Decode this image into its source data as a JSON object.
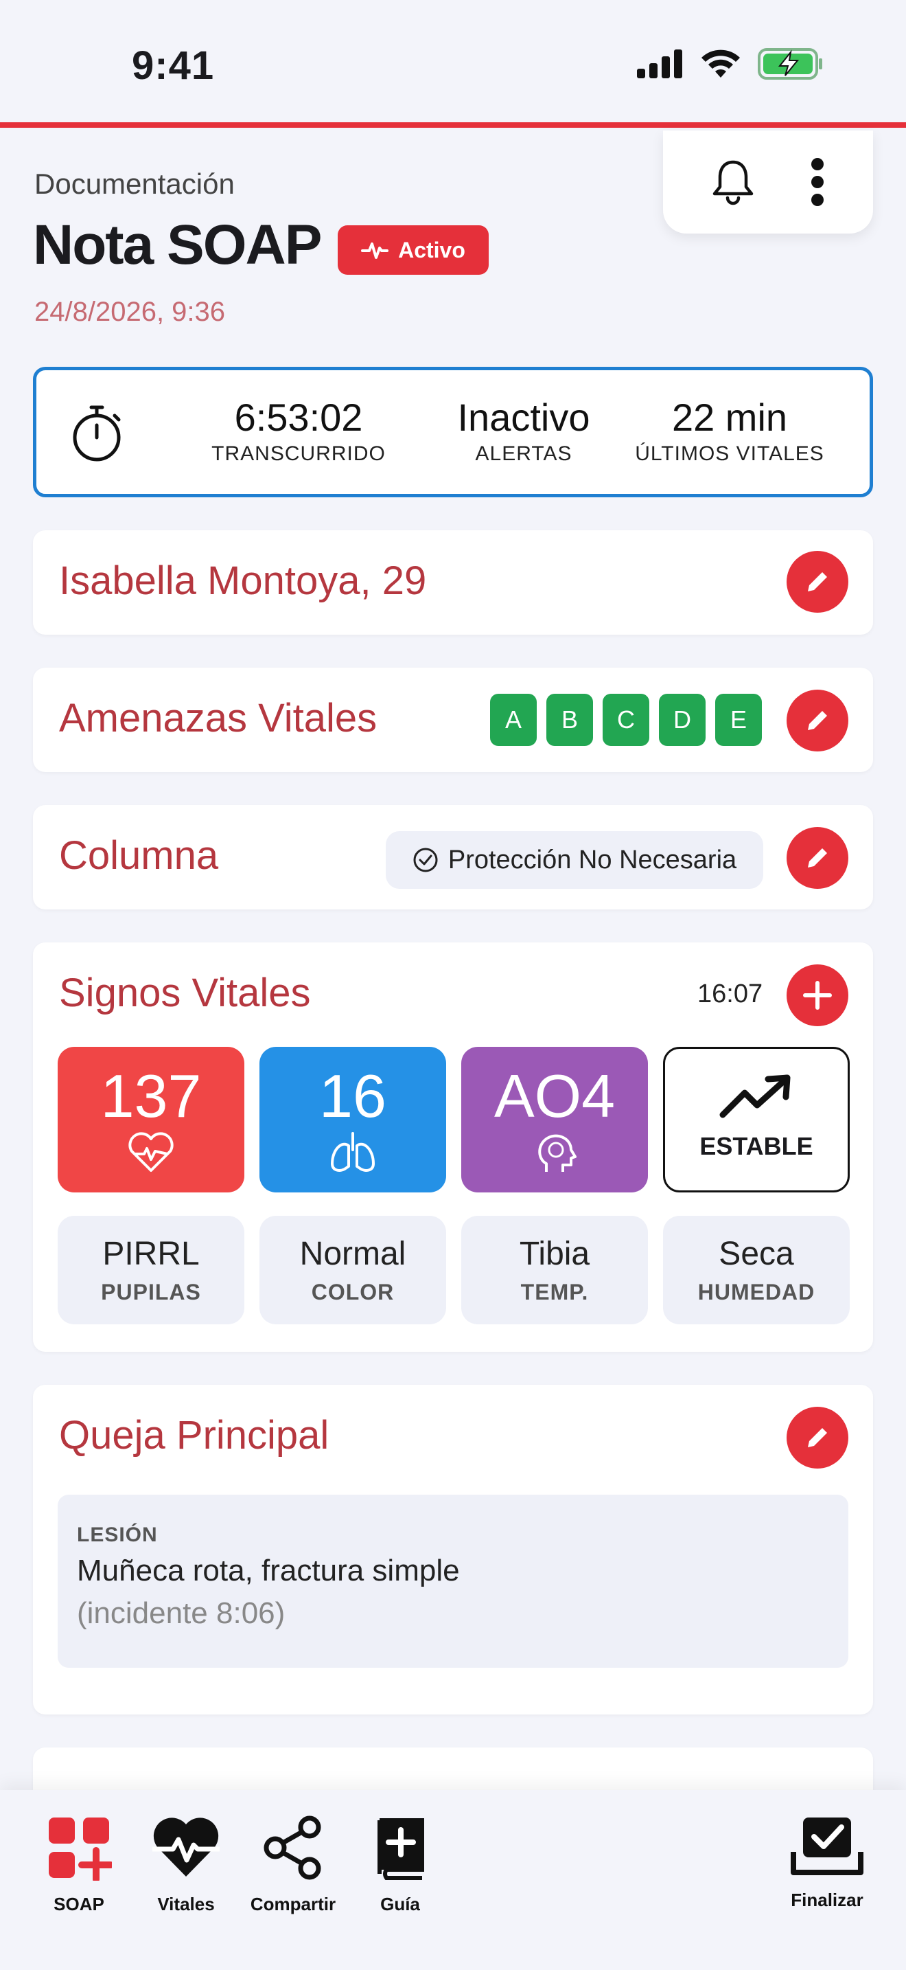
{
  "status_bar": {
    "time": "9:41"
  },
  "header": {
    "subtitle": "Documentación",
    "title": "Nota SOAP",
    "badge": "Activo",
    "date": "24/8/2026, 9:36"
  },
  "timer": {
    "stats": [
      {
        "value": "6:53:02",
        "label": "TRANSCURRIDO"
      },
      {
        "value": "Inactivo",
        "label": "ALERTAS"
      },
      {
        "value": "22 min",
        "label": "ÚLTIMOS VITALES"
      }
    ]
  },
  "patient": {
    "name": "Isabella Montoya, 29"
  },
  "threats": {
    "title": "Amenazas Vitales",
    "letters": [
      "A",
      "B",
      "C",
      "D",
      "E"
    ]
  },
  "spine": {
    "title": "Columna",
    "status": "Protección No Necesaria"
  },
  "vitals": {
    "title": "Signos Vitales",
    "time": "16:07",
    "heart_rate": "137",
    "resp_rate": "16",
    "avpu": "AO4",
    "trend": "ESTABLE",
    "colors": {
      "heart": "#f04646",
      "resp": "#2591e6",
      "neuro": "#9b59b6"
    },
    "details": [
      {
        "value": "PIRRL",
        "label": "PUPILAS"
      },
      {
        "value": "Normal",
        "label": "COLOR"
      },
      {
        "value": "Tibia",
        "label": "TEMP."
      },
      {
        "value": "Seca",
        "label": "HUMEDAD"
      }
    ]
  },
  "complaint": {
    "title": "Queja Principal",
    "label": "LESIÓN",
    "text": "Muñeca rota, fractura simple",
    "sub": "(incidente 8:06)"
  },
  "nav": {
    "items": [
      {
        "label": "SOAP",
        "icon": "soap-grid-icon"
      },
      {
        "label": "Vitales",
        "icon": "heart-pulse-icon"
      },
      {
        "label": "Compartir",
        "icon": "share-icon"
      },
      {
        "label": "Guía",
        "icon": "guide-book-icon"
      }
    ],
    "finish": {
      "label": "Finalizar",
      "icon": "checkbox-tray-icon"
    }
  }
}
